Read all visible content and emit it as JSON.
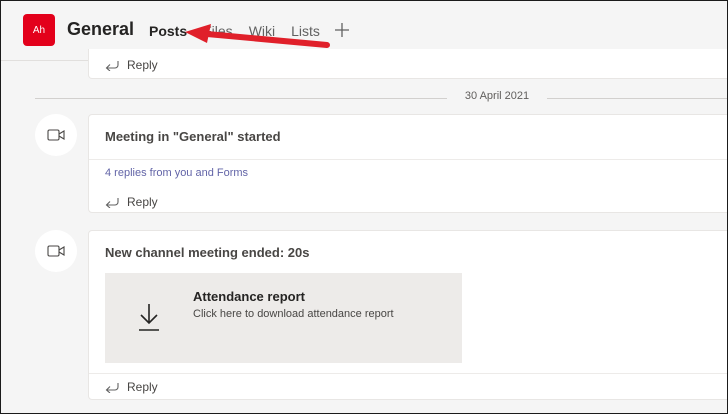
{
  "header": {
    "team_initials": "Ah",
    "channel_name": "General",
    "tabs": [
      {
        "label": "Posts"
      },
      {
        "label": "Files"
      },
      {
        "label": "Wiki"
      },
      {
        "label": "Lists"
      }
    ],
    "add_tab_icon": "plus-icon"
  },
  "feed": {
    "reply_label": "Reply",
    "date_separator": "30 April 2021",
    "posts": [
      {
        "title": "Meeting in \"General\" started",
        "replies_summary": "4 replies from you and Forms",
        "reply_label": "Reply"
      },
      {
        "title": "New channel meeting ended: 20s",
        "attachment": {
          "title": "Attendance report",
          "subtitle": "Click here to download attendance report"
        },
        "reply_label": "Reply"
      }
    ]
  },
  "colors": {
    "team_avatar": "#e3001b",
    "accent": "#6264a7",
    "annotation_arrow": "#e0202a"
  }
}
